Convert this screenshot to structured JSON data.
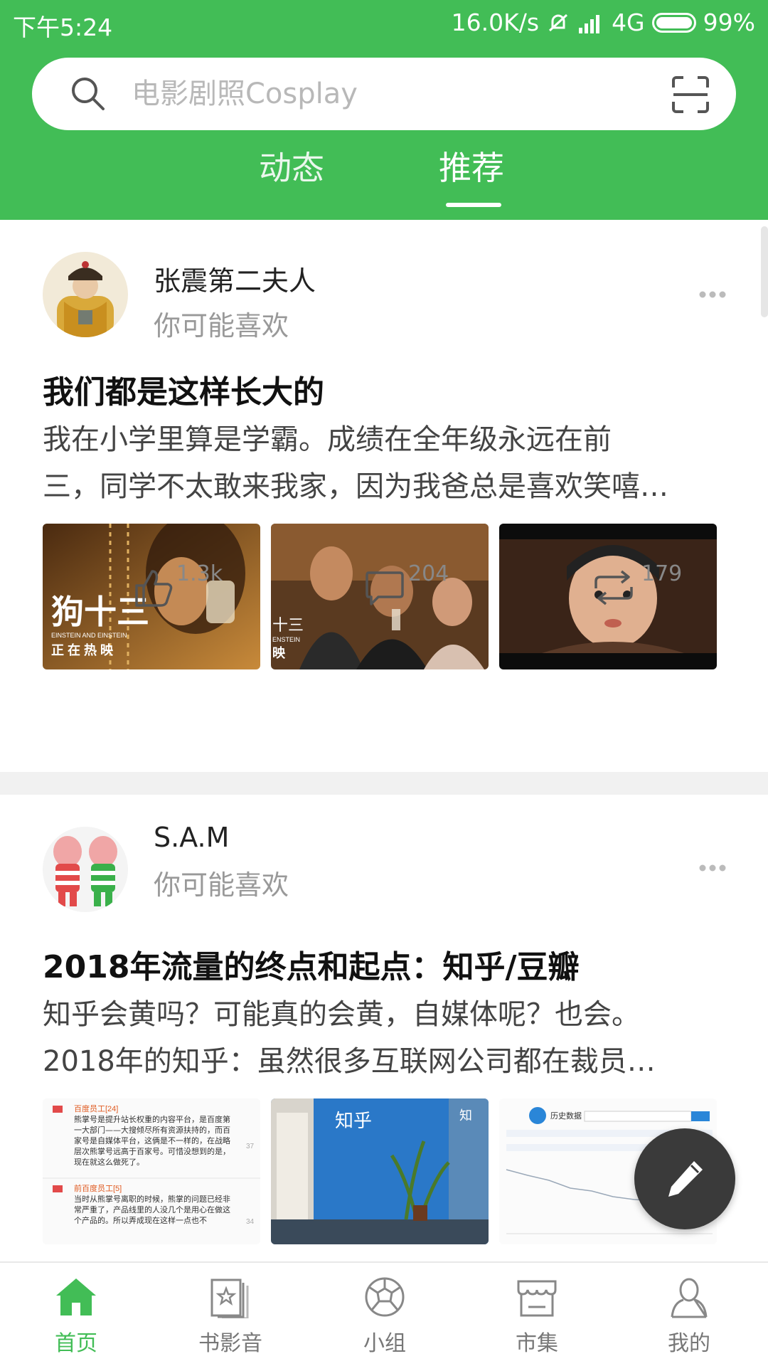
{
  "status_bar": {
    "time": "下午5:24",
    "speed": "16.0K/s",
    "network": "4G",
    "battery": "99%"
  },
  "search": {
    "placeholder": "电影剧照Cosplay"
  },
  "tabs": [
    {
      "label": "动态"
    },
    {
      "label": "推荐",
      "active": true
    }
  ],
  "posts": [
    {
      "author": "张震第二夫人",
      "subtitle": "你可能喜欢",
      "title": "我们都是这样长大的",
      "excerpt_line1": "我在小学里算是学霸。成绩在全年级永远在前",
      "excerpt_line2": "三，同学不太敢来我家，因为我爸总是喜欢笑嘻…",
      "image_text": {
        "poster_title": "狗十三",
        "poster_en": "EINSTEIN AND EINSTEIN",
        "poster_tagline": "正 在 热 映",
        "poster_title_short": "十三",
        "poster_en_short": "ENSTEIN",
        "poster_tagline_short": "映"
      },
      "likes": "1.3k",
      "comments": "204",
      "reshares": "179"
    },
    {
      "author": "S.A.M",
      "subtitle": "你可能喜欢",
      "title": "2018年流量的终点和起点：知乎/豆瓣",
      "excerpt_line1": "知乎会黄吗？可能真的会黄，自媒体呢？也会。",
      "excerpt_line2": "2018年的知乎：虽然很多互联网公司都在裁员…",
      "image_text": {
        "screenshot_user1": "百度员工[24]",
        "screenshot_text1": "熊掌号是提升站长权重的内容平台，是百度第一大部门——大搜倾尽所有资源扶持的，而百家号是自媒体平台，这俩是不一样的，在战略层次熊掌号远高于百家号。可惜没想到的是，现在就这么做死了。",
        "screenshot_user2": "前百度员工[5]",
        "screenshot_text2": "当时从熊掌号离职的时候，熊掌的问题已经非常严重了，产品线里的人没几个是用心在做这个产品的。所以弄成现在这样一点也不",
        "screenshot_count1": "37",
        "screenshot_count2": "34",
        "wall_sign": "知乎",
        "wall_sign_side": "知",
        "chart_site": "历史数据"
      }
    }
  ],
  "bottom_nav": [
    {
      "label": "首页",
      "active": true
    },
    {
      "label": "书影音"
    },
    {
      "label": "小组"
    },
    {
      "label": "市集"
    },
    {
      "label": "我的"
    }
  ],
  "colors": {
    "brand": "#42bd56",
    "fab": "#3a3a3a"
  }
}
